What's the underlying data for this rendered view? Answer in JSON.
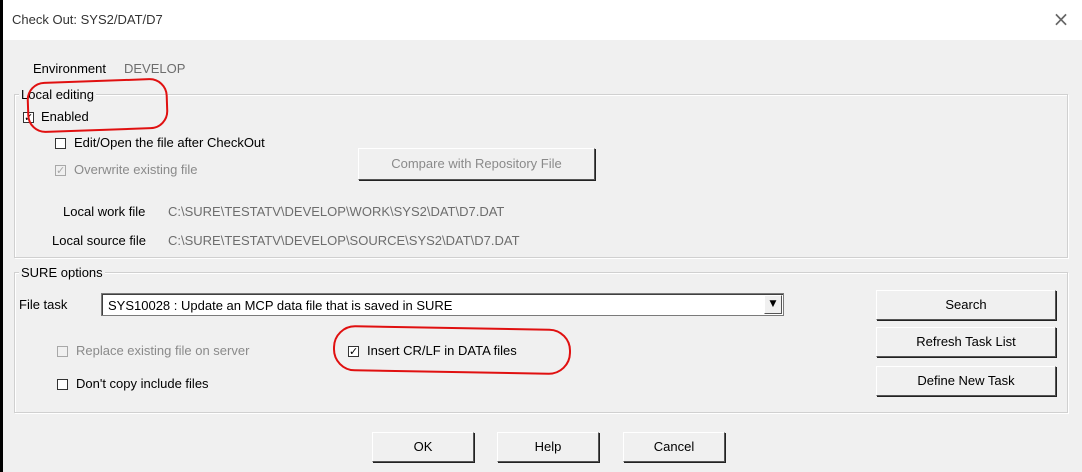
{
  "window": {
    "title": "Check Out: SYS2/DAT/D7",
    "close_glyph": "×"
  },
  "environment": {
    "label": "Environment",
    "value": "DEVELOP"
  },
  "local_editing": {
    "legend": "Local editing",
    "enabled": {
      "label": "Enabled",
      "checked": true
    },
    "edit_open": {
      "label": "Edit/Open the file after CheckOut",
      "checked": false
    },
    "overwrite": {
      "label": "Overwrite existing file",
      "checked": true,
      "disabled": true
    },
    "compare_button": "Compare with Repository File",
    "local_work_file": {
      "label": "Local work file",
      "value": "C:\\SURE\\TESTATV\\DEVELOP\\WORK\\SYS2\\DAT\\D7.DAT"
    },
    "local_source_file": {
      "label": "Local source file",
      "value": "C:\\SURE\\TESTATV\\DEVELOP\\SOURCE\\SYS2\\DAT\\D7.DAT"
    }
  },
  "sure_options": {
    "legend": "SURE options",
    "file_task": {
      "label": "File task",
      "value": "SYS10028 : Update an MCP data file that is saved in SURE"
    },
    "replace_existing": {
      "label": "Replace existing file on server",
      "checked": false,
      "disabled": true
    },
    "insert_crlf": {
      "label": "Insert CR/LF in DATA files",
      "checked": true
    },
    "dont_copy": {
      "label": "Don't copy include files",
      "checked": false
    },
    "search_button": "Search",
    "refresh_button": "Refresh Task List",
    "define_button": "Define New Task"
  },
  "footer": {
    "ok": "OK",
    "help": "Help",
    "cancel": "Cancel"
  },
  "check_glyph": "✓",
  "annotation_color": "#e01010"
}
